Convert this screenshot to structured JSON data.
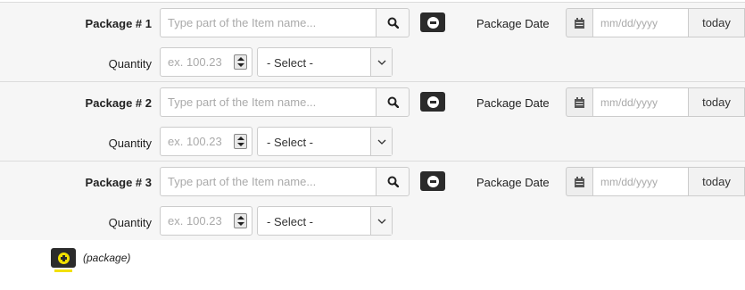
{
  "packages": [
    {
      "label": "Package # 1",
      "item_placeholder": "Type part of the Item name...",
      "date_label": "Package Date",
      "date_placeholder": "mm/dd/yyyy",
      "today_label": "today",
      "quantity_label": "Quantity",
      "quantity_placeholder": "ex. 100.23",
      "unit_selected": "- Select -"
    },
    {
      "label": "Package # 2",
      "item_placeholder": "Type part of the Item name...",
      "date_label": "Package Date",
      "date_placeholder": "mm/dd/yyyy",
      "today_label": "today",
      "quantity_label": "Quantity",
      "quantity_placeholder": "ex. 100.23",
      "unit_selected": "- Select -"
    },
    {
      "label": "Package # 3",
      "item_placeholder": "Type part of the Item name...",
      "date_label": "Package Date",
      "date_placeholder": "mm/dd/yyyy",
      "today_label": "today",
      "quantity_label": "Quantity",
      "quantity_placeholder": "ex. 100.23",
      "unit_selected": "- Select -"
    }
  ],
  "add_package": {
    "label": "(package)",
    "icon": "plus-circle-icon"
  },
  "icons": {
    "search": "search-icon",
    "remove": "minus-circle-icon",
    "calendar": "calendar-icon",
    "spinner": "spinner-icon",
    "dropdown": "chevron-down-icon"
  },
  "colors": {
    "row_background": "#f6f6f6",
    "button_dark": "#2b2b2b",
    "accent_yellow": "#f2e000",
    "border": "#cccccc"
  }
}
